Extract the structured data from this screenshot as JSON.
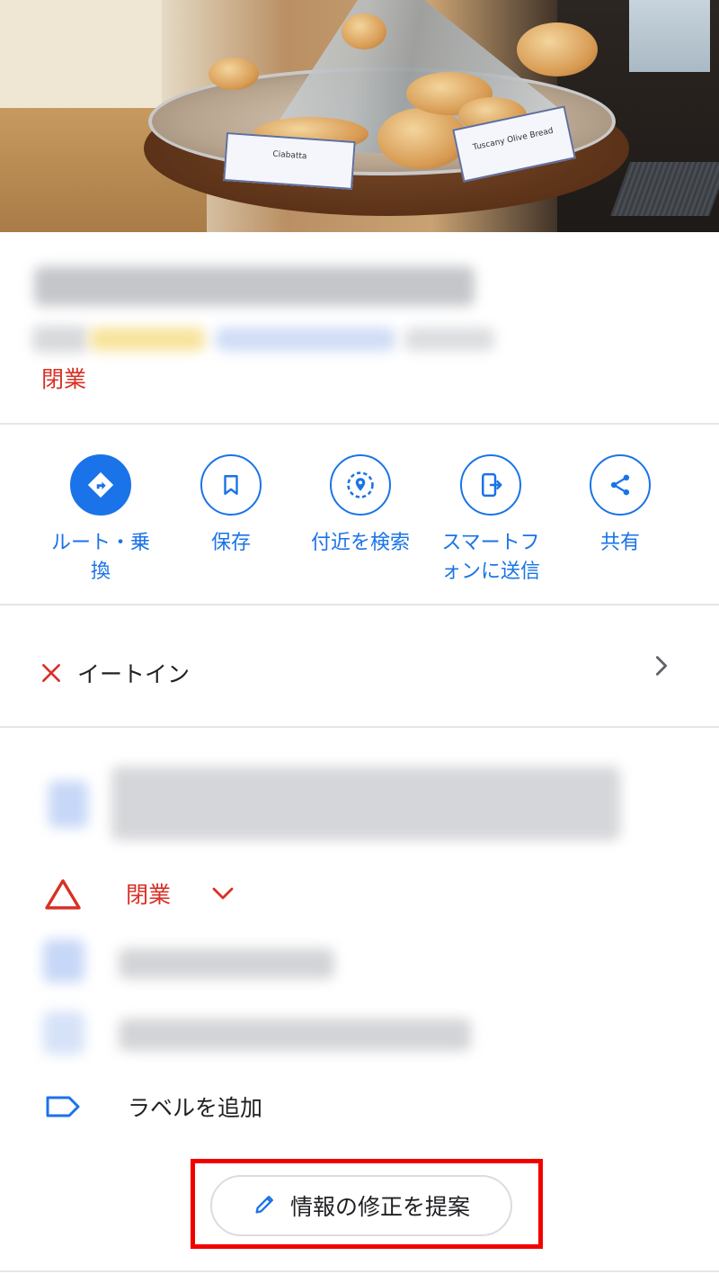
{
  "hero": {
    "sign_left": "Ciabatta",
    "sign_right": "Tuscany Olive Bread"
  },
  "place": {
    "status": "閉業"
  },
  "actions": [
    {
      "label": "ルート・乗換",
      "icon": "directions-icon"
    },
    {
      "label": "保存",
      "icon": "bookmark-icon"
    },
    {
      "label": "付近を検索",
      "icon": "nearby-search-icon"
    },
    {
      "label": "スマートフォンに送信",
      "icon": "send-to-phone-icon"
    },
    {
      "label": "共有",
      "icon": "share-icon"
    }
  ],
  "action_labels": {
    "directions_line1": "ルート・乗",
    "directions_line2": "換",
    "save": "保存",
    "nearby": "付近を検索",
    "send_line1": "スマートフ",
    "send_line2": "ォンに送信",
    "share": "共有"
  },
  "features": {
    "eat_in": "イートイン"
  },
  "details": {
    "status": "閉業",
    "add_label": "ラベルを追加"
  },
  "suggest_edit": {
    "label": "情報の修正を提案"
  },
  "colors": {
    "accent": "#1a73e8",
    "closed": "#d93025",
    "highlight_frame": "#f20000"
  }
}
